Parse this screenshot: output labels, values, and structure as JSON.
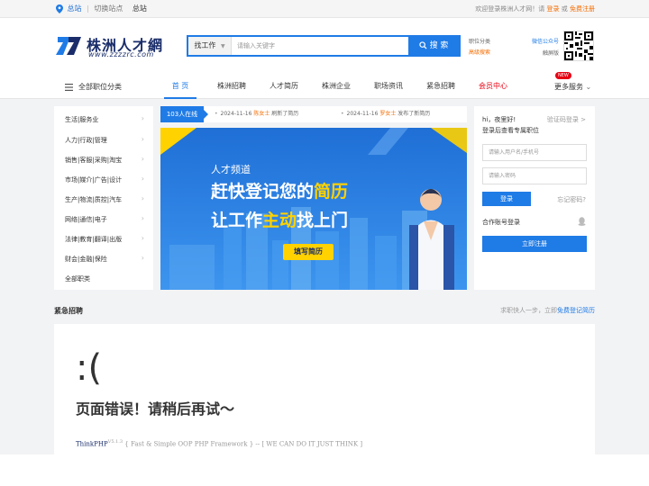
{
  "topbar": {
    "current_site": "总站",
    "switch_label": "切换站点",
    "site_label": "总站",
    "welcome": "欢迎登录株洲人才网！请",
    "login_link": "登录",
    "or": "或",
    "register_link": "免费注册"
  },
  "logo": {
    "cn": "株洲人才網",
    "en": "www.zzzzrc.com"
  },
  "search": {
    "type_label": "找工作",
    "placeholder": "请输入关键字",
    "button_label": "搜 索"
  },
  "header_links": {
    "job_category": "职位分类",
    "advanced_search": "高级搜索",
    "wechat": "微信公众号",
    "touch_screen": "触屏版"
  },
  "nav": {
    "all_categories": "全部职位分类",
    "items": [
      "首 页",
      "株洲招聘",
      "人才简历",
      "株洲企业",
      "职场资讯",
      "紧急招聘",
      "会员中心"
    ],
    "more": "更多服务",
    "new_badge": "NEW"
  },
  "categories": [
    "生活|服务业",
    "人力|行政|管理",
    "销售|客服|采购|淘宝",
    "市场|媒介|广告|设计",
    "生产|物流|质控|汽车",
    "网络|通信|电子",
    "法律|教育|翻译|出版",
    "财会|金融|保险",
    "全部职类"
  ],
  "ticker": {
    "online": "103人在线",
    "entries": [
      {
        "date": "2024-11-16",
        "name": "陈女士",
        "action": "刷新了简历"
      },
      {
        "date": "2024-11-16",
        "name": "罗女士",
        "action": "发布了新简历"
      }
    ]
  },
  "banner": {
    "tag": "人才频道",
    "line1_a": "赶快登记您的",
    "line1_b": "简历",
    "line2_a": "让工作",
    "line2_b": "主动",
    "line2_c": "找上门",
    "button": "填写简历",
    "colors": {
      "accent": "#ffd200",
      "bg": "#1f7be6"
    }
  },
  "login": {
    "greeting": "hi，夜里好!",
    "code_login": "验证码登录 >",
    "subtitle": "登录后查看专属职位",
    "username_placeholder": "请输入用户名/手机号",
    "password_placeholder": "请输入密码",
    "login_button": "登录",
    "forgot": "忘记密码?",
    "coop": "合作账号登录",
    "register_button": "立即注册"
  },
  "urgent": {
    "title": "紧急招聘",
    "hint": "求职快人一步，立即",
    "hint_link": "免费登记简历"
  },
  "error": {
    "face": ":(",
    "message": "页面错误！请稍后再试～",
    "framework": "ThinkPHP",
    "version": "V5.1.3",
    "slogan": "{ Fast & Simple OOP PHP Framework } -- [ WE CAN DO IT JUST THINK ]"
  }
}
